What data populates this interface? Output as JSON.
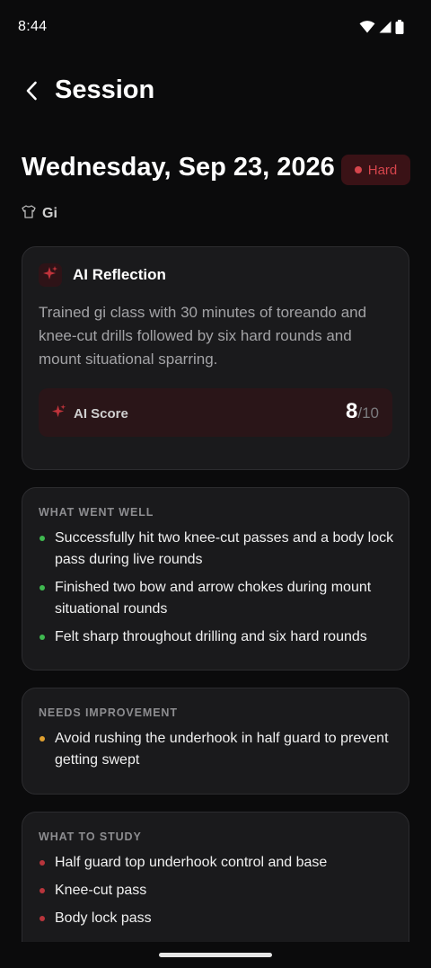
{
  "status_bar": {
    "time": "8:44"
  },
  "header": {
    "title": "Session"
  },
  "session": {
    "date": "Wednesday, Sep 23, 2026",
    "intensity": "Hard",
    "uniform": "Gi"
  },
  "ai_reflection": {
    "title": "AI Reflection",
    "summary": "Trained gi class with 30 minutes of toreando and knee-cut drills followed by six hard rounds and mount situational sparring.",
    "score_label": "AI Score",
    "score": "8",
    "score_max": "/10"
  },
  "went_well": {
    "heading": "WHAT WENT WELL",
    "items": [
      "Successfully hit two knee-cut passes and a body lock pass during live rounds",
      "Finished two bow and arrow chokes during mount situational rounds",
      "Felt sharp throughout drilling and six hard rounds"
    ]
  },
  "needs_improvement": {
    "heading": "NEEDS IMPROVEMENT",
    "items": [
      "Avoid rushing the underhook in half guard to prevent getting swept"
    ]
  },
  "to_study": {
    "heading": "WHAT TO STUDY",
    "items": [
      "Half guard top underhook control and base",
      "Knee-cut pass",
      "Body lock pass"
    ]
  },
  "colors": {
    "background": "#0b0b0c",
    "card": "#1a1a1c",
    "accent_red": "#d6454c",
    "bullet_green": "#3fb950",
    "bullet_orange": "#e0a030",
    "bullet_red": "#b8353c"
  },
  "icons": {
    "back": "chevron-left-icon",
    "uniform": "shirt-icon",
    "ai": "sparkle-icon",
    "wifi": "wifi-icon",
    "signal": "signal-icon",
    "battery": "battery-icon"
  }
}
